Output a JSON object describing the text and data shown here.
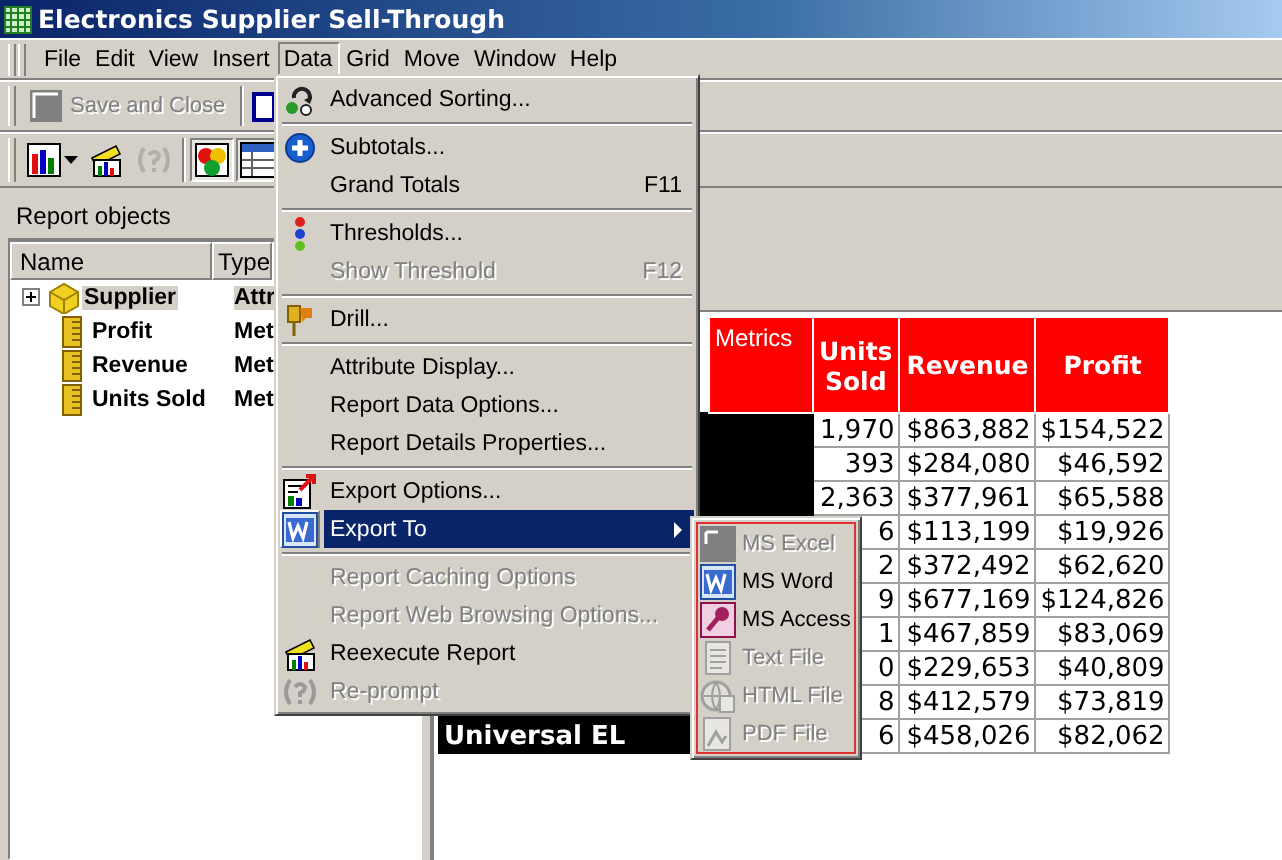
{
  "window": {
    "title": "Electronics Supplier Sell-Through"
  },
  "menu_bar": [
    {
      "label": "File",
      "selected": false
    },
    {
      "label": "Edit",
      "selected": false
    },
    {
      "label": "View",
      "selected": false
    },
    {
      "label": "Insert",
      "selected": false
    },
    {
      "label": "Data",
      "selected": true
    },
    {
      "label": "Grid",
      "selected": false
    },
    {
      "label": "Move",
      "selected": false
    },
    {
      "label": "Window",
      "selected": false
    },
    {
      "label": "Help",
      "selected": false
    }
  ],
  "toolbar_1": {
    "save_button": {
      "label": "Save and Close",
      "disabled": true
    }
  },
  "toolbar_2": {
    "buttons": [
      {
        "kind": "chart",
        "pressed": false,
        "disabled": false
      },
      {
        "kind": "reexecute",
        "pressed": false,
        "disabled": false
      },
      {
        "kind": "prompt",
        "pressed": false,
        "disabled": true
      },
      {
        "kind": "design",
        "pressed": true,
        "disabled": false
      },
      {
        "kind": "grid",
        "pressed": true,
        "disabled": false
      }
    ]
  },
  "report_objects": {
    "title": "Report objects",
    "columns": [
      "Name",
      "Type"
    ],
    "rows": [
      {
        "kind": "attribute",
        "name": "Supplier",
        "type": "Attr",
        "selected": true,
        "expanded": false
      },
      {
        "kind": "metric",
        "name": "Profit",
        "type": "Met",
        "selected": false
      },
      {
        "kind": "metric",
        "name": "Revenue",
        "type": "Met",
        "selected": false
      },
      {
        "kind": "metric",
        "name": "Units Sold",
        "type": "Met",
        "selected": false
      }
    ]
  },
  "report_grid": {
    "metrics_header": "Metrics",
    "columns": [
      "Units\nSold",
      "Revenue",
      "Profit"
    ],
    "rows": [
      {
        "units_sold": "1,970",
        "revenue": "$863,882",
        "profit": "$154,522"
      },
      {
        "units_sold": "393",
        "revenue": "$284,080",
        "profit": "$46,592"
      },
      {
        "units_sold": "2,363",
        "revenue": "$377,961",
        "profit": "$65,588"
      },
      {
        "units_sold": "6",
        "revenue": "$113,199",
        "profit": "$19,926"
      },
      {
        "units_sold": "2",
        "revenue": "$372,492",
        "profit": "$62,620"
      },
      {
        "units_sold": "9",
        "revenue": "$677,169",
        "profit": "$124,826"
      },
      {
        "units_sold": "1",
        "revenue": "$467,859",
        "profit": "$83,069"
      },
      {
        "units_sold": "0",
        "revenue": "$229,653",
        "profit": "$40,809"
      },
      {
        "units_sold": "8",
        "revenue": "$412,579",
        "profit": "$73,819"
      },
      {
        "row_header": "Universal EL",
        "units_sold": "6",
        "revenue": "$458,026",
        "profit": "$82,062"
      }
    ]
  },
  "data_menu": {
    "items": [
      {
        "kind": "item",
        "label": "Advanced Sorting...",
        "disabled": false,
        "selected": false,
        "submenu": false
      },
      {
        "kind": "separator"
      },
      {
        "kind": "item",
        "label": "Subtotals...",
        "disabled": false,
        "selected": false,
        "submenu": false
      },
      {
        "kind": "item",
        "label": "Grand Totals",
        "shortcut": "F11",
        "disabled": false,
        "selected": false,
        "submenu": false
      },
      {
        "kind": "separator"
      },
      {
        "kind": "item",
        "label": "Thresholds...",
        "disabled": false,
        "selected": false,
        "submenu": false
      },
      {
        "kind": "item",
        "label": "Show Threshold",
        "shortcut": "F12",
        "disabled": true,
        "selected": false,
        "submenu": false
      },
      {
        "kind": "separator"
      },
      {
        "kind": "item",
        "label": "Drill...",
        "disabled": false,
        "selected": false,
        "submenu": false
      },
      {
        "kind": "separator"
      },
      {
        "kind": "item",
        "label": "Attribute Display...",
        "disabled": false,
        "selected": false,
        "submenu": false
      },
      {
        "kind": "item",
        "label": "Report Data Options...",
        "disabled": false,
        "selected": false,
        "submenu": false
      },
      {
        "kind": "item",
        "label": "Report Details Properties...",
        "disabled": false,
        "selected": false,
        "submenu": false
      },
      {
        "kind": "separator"
      },
      {
        "kind": "item",
        "label": "Export Options...",
        "disabled": false,
        "selected": false,
        "submenu": false
      },
      {
        "kind": "item",
        "label": "Export To",
        "disabled": false,
        "selected": true,
        "submenu": true
      },
      {
        "kind": "separator"
      },
      {
        "kind": "item",
        "label": "Report Caching Options",
        "disabled": true,
        "selected": false,
        "submenu": false
      },
      {
        "kind": "item",
        "label": "Report Web Browsing Options...",
        "disabled": true,
        "selected": false,
        "submenu": false
      },
      {
        "kind": "item",
        "label": "Reexecute Report",
        "disabled": false,
        "selected": false,
        "submenu": false
      },
      {
        "kind": "item",
        "label": "Re-prompt",
        "disabled": true,
        "selected": false,
        "submenu": false
      }
    ]
  },
  "export_submenu": {
    "items": [
      {
        "label": "MS Excel",
        "disabled": true
      },
      {
        "label": "MS Word",
        "disabled": false
      },
      {
        "label": "MS Access",
        "disabled": false
      },
      {
        "label": "Text File",
        "disabled": true
      },
      {
        "label": "HTML File",
        "disabled": true
      },
      {
        "label": "PDF File",
        "disabled": true
      }
    ]
  }
}
